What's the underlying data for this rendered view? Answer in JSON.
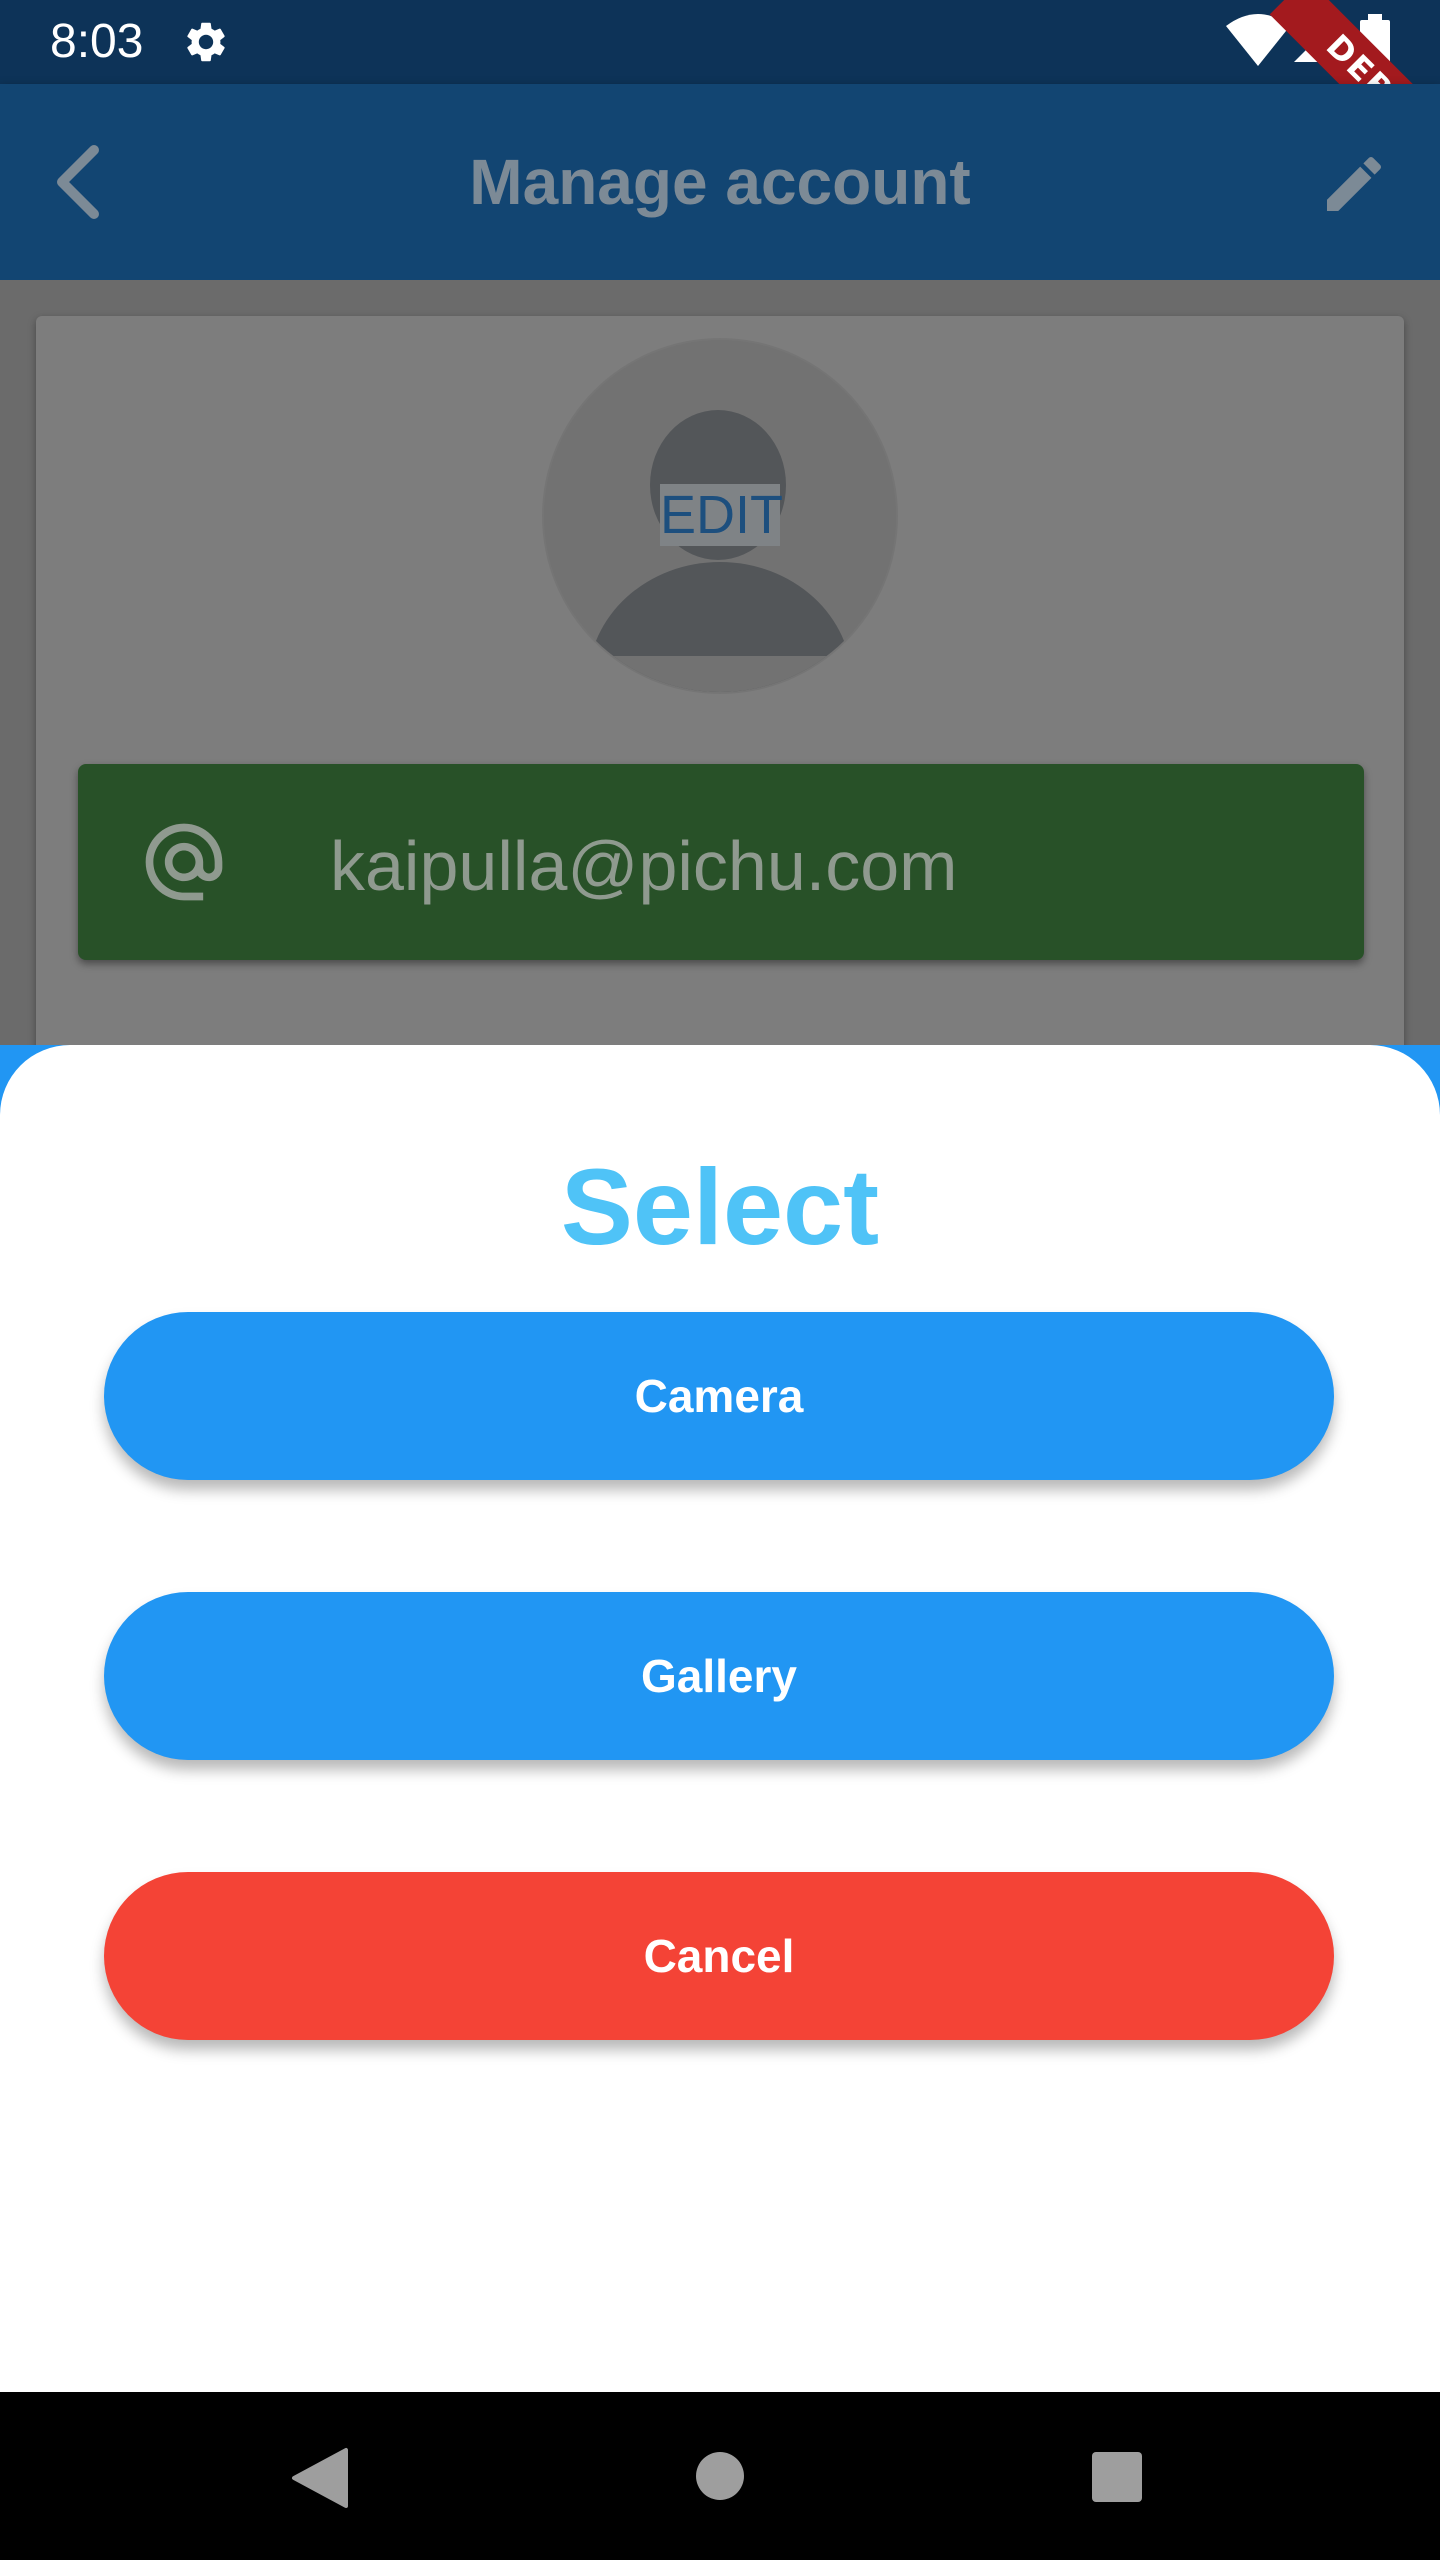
{
  "status_bar": {
    "time": "8:03",
    "icons": [
      "settings-icon",
      "wifi-icon",
      "signal-icon",
      "battery-icon"
    ]
  },
  "debug_banner": {
    "label": "DEBUG",
    "color": "#a31a1e"
  },
  "app_bar": {
    "title": "Manage account",
    "back_icon": "arrow-back-icon",
    "action_icon": "pencil-icon",
    "color": "#124572"
  },
  "profile": {
    "avatar_icon": "person-icon",
    "edit_label": "EDIT",
    "email_icon": "at-sign-icon",
    "email": "kaipulla@pichu.com",
    "email_field_color": "#285128"
  },
  "bottom_sheet": {
    "title": "Select",
    "title_color": "#4fc3f7",
    "buttons": [
      {
        "label": "Camera",
        "color": "#2196f3"
      },
      {
        "label": "Gallery",
        "color": "#2196f3"
      },
      {
        "label": "Cancel",
        "color": "#f44336"
      }
    ]
  },
  "nav_bar": {
    "icons": [
      "nav-back-icon",
      "nav-home-icon",
      "nav-recents-icon"
    ]
  }
}
